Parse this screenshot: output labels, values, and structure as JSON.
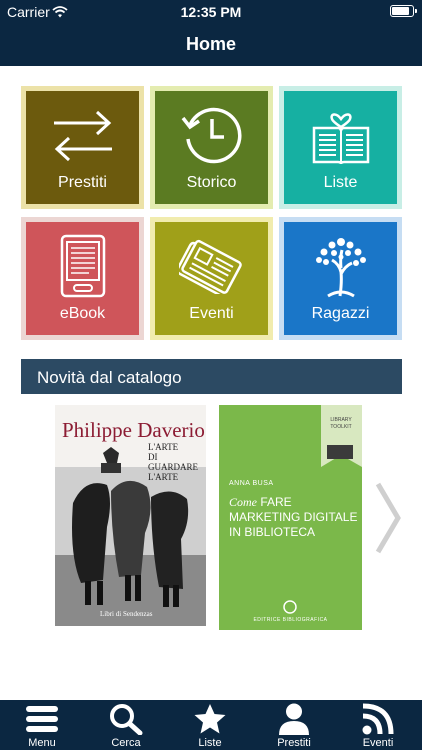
{
  "status_bar": {
    "carrier": "Carrier",
    "time": "12:35 PM",
    "battery_level": 0.95
  },
  "nav": {
    "title": "Home"
  },
  "tiles": [
    {
      "label": "Prestiti",
      "icon": "arrows-exchange-icon",
      "color": "#6c5a0d",
      "border": "#ece2a8"
    },
    {
      "label": "Storico",
      "icon": "history-clock-icon",
      "color": "#5b7b22",
      "border": "#e4ecb0"
    },
    {
      "label": "Liste",
      "icon": "book-heart-icon",
      "color": "#16b0a2",
      "border": "#c8eee6"
    },
    {
      "label": "eBook",
      "icon": "ereader-icon",
      "color": "#cf555a",
      "border": "#ecd6d3"
    },
    {
      "label": "Eventi",
      "icon": "newspaper-icon",
      "color": "#a0a019",
      "border": "#f1ecae"
    },
    {
      "label": "Ragazzi",
      "icon": "tree-icon",
      "color": "#1a76c8",
      "border": "#c6ddf3"
    }
  ],
  "section": {
    "title": "Novità dal catalogo"
  },
  "books": [
    {
      "author": "Philippe Daverio",
      "subtitle": [
        "L'ARTE",
        "DI GUARDARE",
        "L'ARTE"
      ],
      "publisher": "Libri di Sendenzas"
    },
    {
      "badge": [
        "LIBRARY",
        "TOOLKIT"
      ],
      "author": "ANNA BUSA",
      "title_script": "Come",
      "title_lines": [
        "FARE",
        "MARKETING DIGITALE",
        "IN BIBLIOTECA"
      ],
      "publisher": "EDITRICE BIBLIOGRAFICA"
    }
  ],
  "tabbar": [
    {
      "label": "Menu",
      "icon": "hamburger-menu-icon"
    },
    {
      "label": "Cerca",
      "icon": "search-icon"
    },
    {
      "label": "Liste",
      "icon": "star-icon"
    },
    {
      "label": "Prestiti",
      "icon": "user-icon"
    },
    {
      "label": "Eventi",
      "icon": "rss-icon"
    }
  ],
  "colors": {
    "bar": "#0b2741",
    "section": "#2c4a63"
  }
}
